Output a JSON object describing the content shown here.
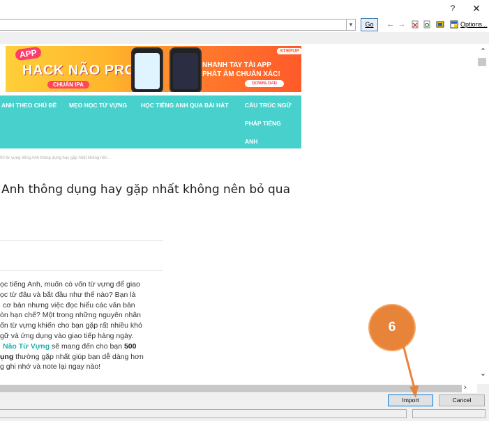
{
  "titlebar": {
    "help_label": "?",
    "close_label": "✕"
  },
  "addressbar": {
    "url_value": "",
    "go_label": "Go",
    "options_label": "Options..."
  },
  "toolbar_icons": [
    "back-arrow-icon",
    "forward-arrow-icon",
    "stop-icon",
    "refresh-icon",
    "save-query-icon",
    "options-icon"
  ],
  "webpage": {
    "banner": {
      "badge": "APP",
      "title": "HACK NÃO PRO",
      "subtitle": "CHUẨN IPA",
      "brand": "STEPUP",
      "line1": "NHANH TAY TẢI APP",
      "line2": "PHÁT ÂM CHUẨN XÁC!",
      "download": "DOWNLOAD"
    },
    "nav": {
      "items": [
        "ANH THEO CHỦ ĐỀ",
        "MẸO HỌC TỪ VỰNG",
        "HỌC TIẾNG ANH QUA BÀI HÁT",
        "CẤU TRÚC NGỮ",
        "PHÁP TIẾNG",
        "ANH"
      ]
    },
    "breadcrumb": "00 từ vựng tiếng Anh thông dụng hay gặp nhất không nên...",
    "title": "Anh thông dụng hay gặp nhất không nên bỏ qua",
    "paragraph": [
      "ọc tiếng Anh, muốn có vốn từ vựng để giao",
      "ọc từ đâu và bắt đầu như thế nào? Bạn là",
      "cơ bản nhưng việc đọc hiểu các văn bản",
      "òn hạn chế? Một trong những nguyên nhân",
      "ốn từ vựng khiến cho bạn gặp rất nhiều khó",
      "gữ và ứng dụng vào giao tiếp hàng ngày.",
      "Não Từ Vựng",
      "sẽ mang đến cho bạn",
      "500",
      "ụng",
      "thường gặp nhất giúp bạn dễ dàng hơn",
      "g ghi nhớ và note lại ngay nào!"
    ]
  },
  "buttons": {
    "import_label": "Import",
    "cancel_label": "Cancel"
  },
  "callout": {
    "number": "6",
    "color": "#e8833a"
  },
  "colors": {
    "nav_bg": "#48d1cc",
    "highlight": "#20b2aa",
    "callout": "#e8833a"
  }
}
